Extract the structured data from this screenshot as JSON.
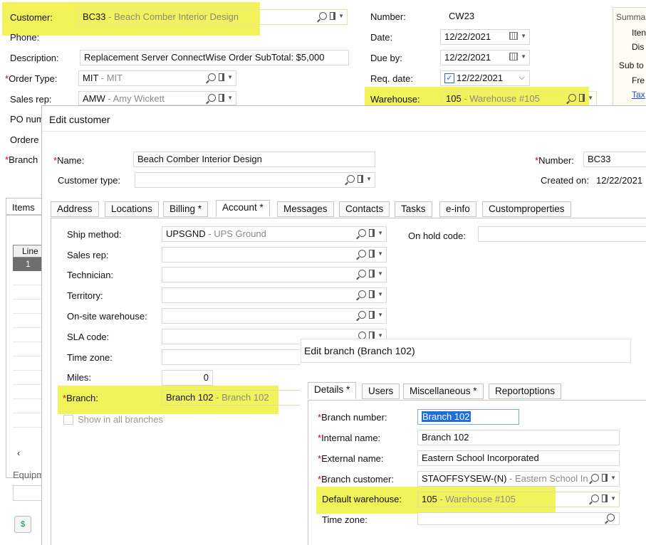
{
  "order": {
    "customer_label": "Customer:",
    "customer_code": "BC33",
    "customer_name": "- Beach Comber Interior Design",
    "phone_label": "Phone:",
    "description_label": "Description:",
    "description_value": "Replacement Server ConnectWise Order SubTotal: $5,000",
    "order_type_label": "Order Type:",
    "order_type_code": "MIT",
    "order_type_name": "- MIT",
    "sales_rep_label": "Sales rep:",
    "sales_rep_code": "AMW",
    "sales_rep_name": "- Amy Wickett",
    "po_label": "PO num",
    "ordered_label": "Ordere",
    "branch_label": "Branch",
    "number_label": "Number:",
    "number_value": "CW23",
    "date_label": "Date:",
    "date_value": "12/22/2021",
    "due_label": "Due by:",
    "due_value": "12/22/2021",
    "req_label": "Req. date:",
    "req_value": "12/22/2021",
    "warehouse_label": "Warehouse:",
    "warehouse_code": "105",
    "warehouse_name": "- Warehouse #105",
    "summary": [
      "Summa",
      "Iten",
      "Dis",
      "Sub to",
      "Fre",
      "Tax"
    ],
    "items_tab": "Items",
    "line_header": "Line",
    "line_first": "1",
    "equip_label": "Equipm"
  },
  "edit_customer": {
    "title": "Edit customer",
    "name_label": "Name:",
    "name_value": "Beach Comber Interior Design",
    "type_label": "Customer type:",
    "number_label": "Number:",
    "number_value": "BC33",
    "created_label": "Created on:",
    "created_value": "12/22/2021",
    "tabs": [
      "Address",
      "Locations",
      "Billing *",
      "Account *",
      "Messages",
      "Contacts",
      "Tasks",
      "e-info",
      "Customproperties"
    ],
    "ship_label": "Ship method:",
    "ship_code": "UPSGND",
    "ship_name": "- UPS Ground",
    "onhold_label": "On hold code:",
    "salesrep_label": "Sales rep:",
    "tech_label": "Technician:",
    "territory_label": "Territory:",
    "onsite_label": "On-site warehouse:",
    "sla_label": "SLA code:",
    "tz_label": "Time zone:",
    "miles_label": "Miles:",
    "miles_value": "0",
    "branch_label": "Branch:",
    "branch_code": "Branch 102",
    "branch_name": "- Branch 102",
    "show_all_label": "Show in all branches"
  },
  "edit_branch": {
    "title": "Edit branch (Branch 102)",
    "tabs": [
      "Details *",
      "Users",
      "Miscellaneous *",
      "Reportoptions"
    ],
    "number_label": "Branch number:",
    "number_value": "Branch 102",
    "internal_label": "Internal name:",
    "internal_value": "Branch 102",
    "external_label": "External name:",
    "external_value": "Eastern School Incorporated",
    "customer_label": "Branch customer:",
    "customer_code": "STAOFFSYSEW-(N)",
    "customer_name": "- Eastern School In",
    "warehouse_label": "Default warehouse:",
    "warehouse_code": "105",
    "warehouse_name": "- Warehouse #105",
    "tz_label": "Time zone:"
  },
  "colors": {
    "highlight": "#f2f25a",
    "required": "#d0021b",
    "link": "#1a4fd0"
  }
}
